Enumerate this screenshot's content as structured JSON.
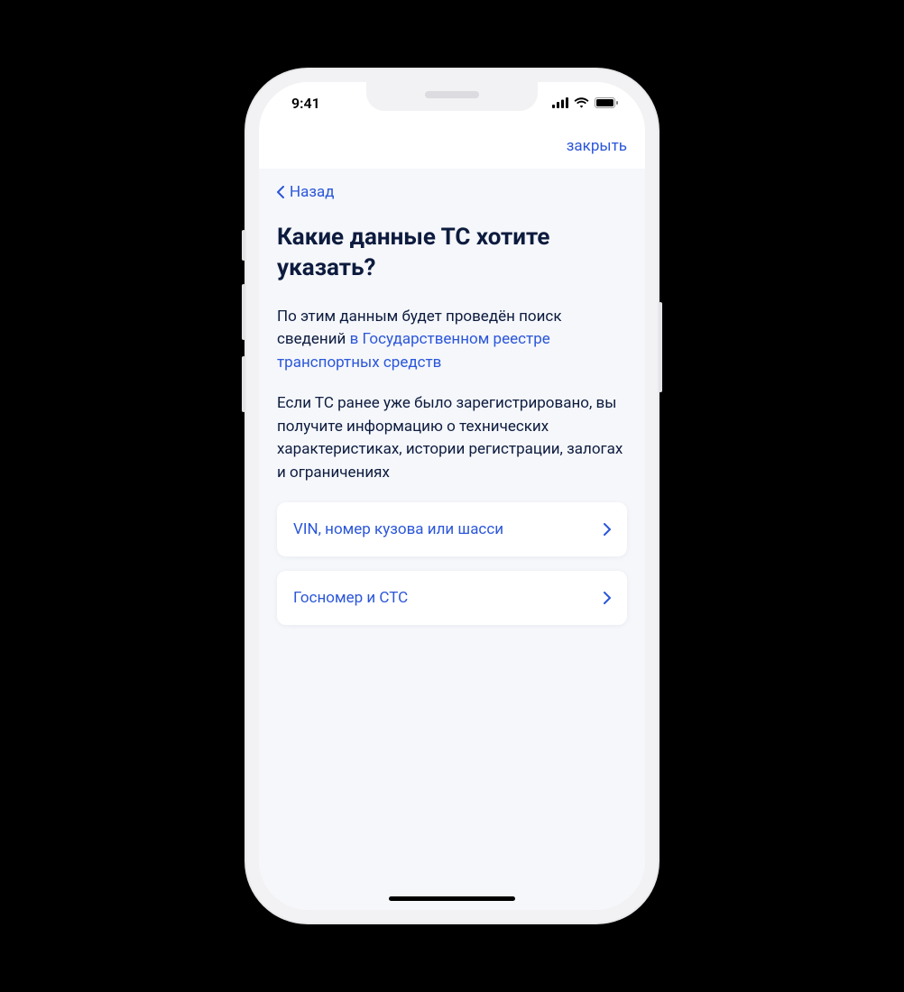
{
  "status": {
    "time": "9:41"
  },
  "topbar": {
    "close_label": "закрыть"
  },
  "nav": {
    "back_label": "Назад"
  },
  "page": {
    "title": "Какие данные ТС хотите указать?",
    "para1_prefix": "По этим данным будет проведён поиск сведений ",
    "para1_link": "в Государственном реестре транспортных средств",
    "para2": "Если ТС ранее уже было зарегистрировано, вы получите информацию о технических характеристиках, истории регистрации, залогах и ограничениях"
  },
  "options": [
    {
      "label": "VIN, номер кузова или шасси"
    },
    {
      "label": "Госномер и СТС"
    }
  ]
}
